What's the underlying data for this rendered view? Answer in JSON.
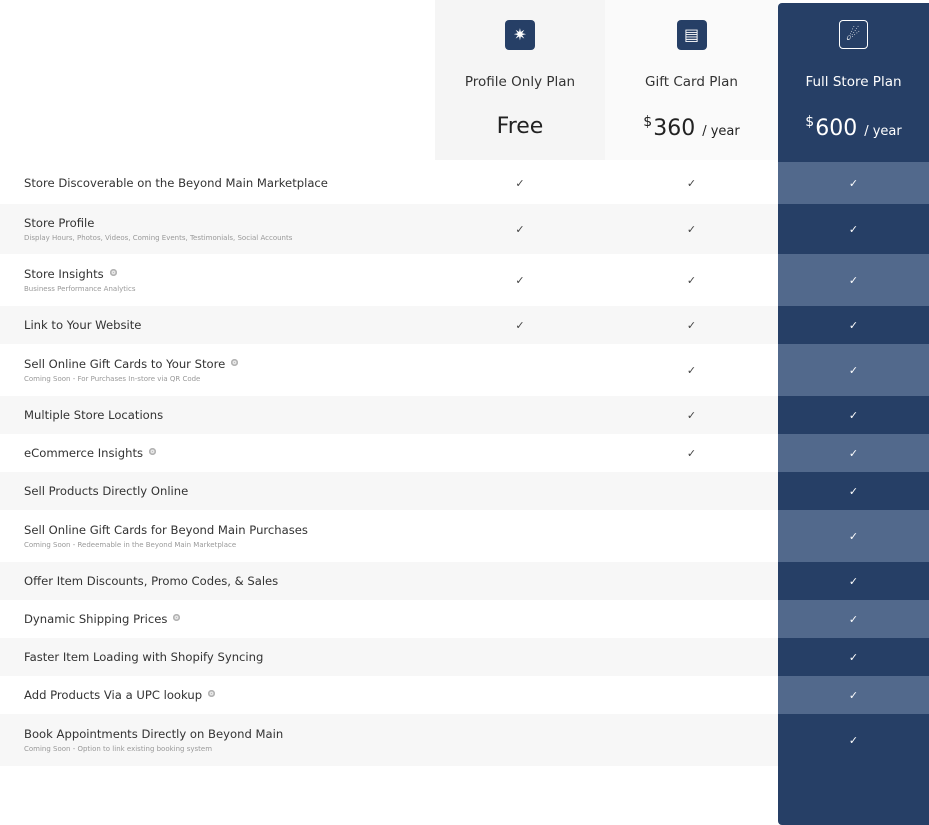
{
  "plans": [
    {
      "icon": "sparkle-icon",
      "glyph": "✷",
      "name": "Profile Only Plan",
      "price": "Free",
      "currency": "",
      "period": ""
    },
    {
      "icon": "gift-card-icon",
      "glyph": "▤",
      "name": "Gift Card Plan",
      "price": "360",
      "currency": "$",
      "period": "/ year"
    },
    {
      "icon": "store-hand-icon",
      "glyph": "☄",
      "name": "Full Store Plan",
      "price": "600",
      "currency": "$",
      "period": "/ year"
    }
  ],
  "check_glyph": "✓",
  "features": [
    {
      "title": "Store Discoverable on the Beyond Main Marketplace",
      "subtitle": "",
      "info": false,
      "plans": [
        true,
        true,
        true
      ]
    },
    {
      "title": "Store Profile",
      "subtitle": "Display Hours, Photos, Videos, Coming Events, Testimonials, Social Accounts",
      "info": false,
      "plans": [
        true,
        true,
        true
      ]
    },
    {
      "title": "Store Insights",
      "subtitle": "Business Performance Analytics",
      "info": true,
      "plans": [
        true,
        true,
        true
      ]
    },
    {
      "title": "Link to Your Website",
      "subtitle": "",
      "info": false,
      "plans": [
        true,
        true,
        true
      ]
    },
    {
      "title": "Sell Online Gift Cards to Your Store",
      "subtitle": "Coming Soon - For Purchases In-store via QR Code",
      "info": true,
      "plans": [
        false,
        true,
        true
      ]
    },
    {
      "title": "Multiple Store Locations",
      "subtitle": "",
      "info": false,
      "plans": [
        false,
        true,
        true
      ]
    },
    {
      "title": "eCommerce Insights",
      "subtitle": "",
      "info": true,
      "plans": [
        false,
        true,
        true
      ]
    },
    {
      "title": "Sell Products Directly Online",
      "subtitle": "",
      "info": false,
      "plans": [
        false,
        false,
        true
      ]
    },
    {
      "title": "Sell Online Gift Cards for Beyond Main Purchases",
      "subtitle": "Coming Soon - Redeemable in the Beyond Main Marketplace",
      "info": false,
      "plans": [
        false,
        false,
        true
      ]
    },
    {
      "title": "Offer Item Discounts, Promo Codes, & Sales",
      "subtitle": "",
      "info": false,
      "plans": [
        false,
        false,
        true
      ]
    },
    {
      "title": "Dynamic Shipping Prices",
      "subtitle": "",
      "info": true,
      "plans": [
        false,
        false,
        true
      ]
    },
    {
      "title": "Faster Item Loading with Shopify Syncing",
      "subtitle": "",
      "info": false,
      "plans": [
        false,
        false,
        true
      ]
    },
    {
      "title": "Add Products Via a UPC lookup",
      "subtitle": "",
      "info": true,
      "plans": [
        false,
        false,
        true
      ]
    },
    {
      "title": "Book Appointments Directly on Beyond Main",
      "subtitle": "Coming Soon - Option to link existing booking system",
      "info": false,
      "plans": [
        false,
        false,
        true
      ]
    }
  ],
  "colors": {
    "brand_navy": "#263f66",
    "navy_light": "#52698c",
    "row_alt": "#f7f7f7"
  }
}
